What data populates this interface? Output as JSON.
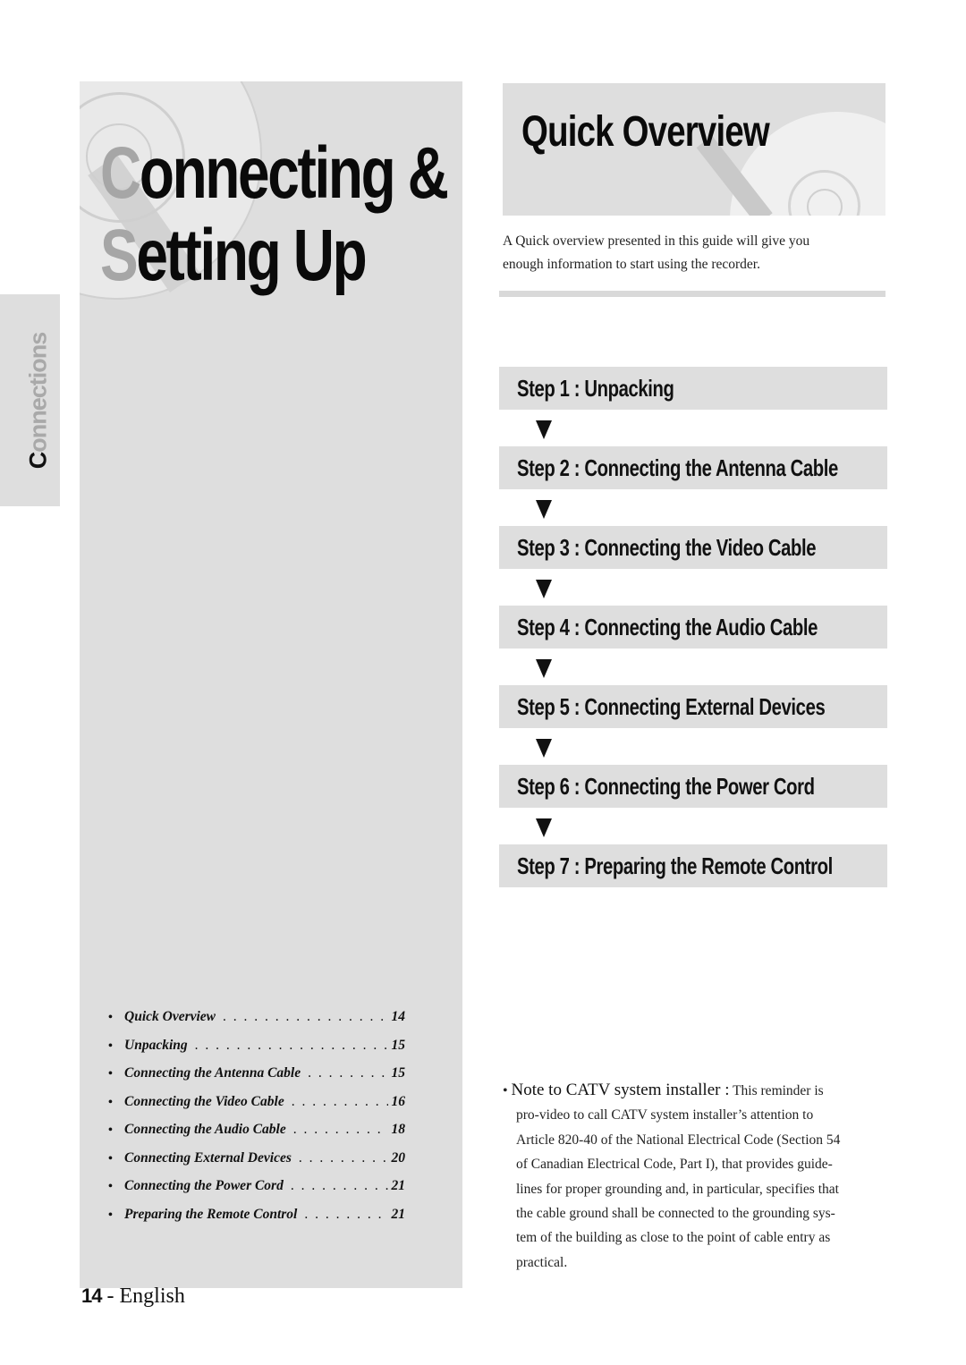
{
  "chapter": {
    "title_line1_initial": "C",
    "title_line1_rest": "onnecting &",
    "title_line2_initial": "S",
    "title_line2_rest": "etting Up"
  },
  "side_tab": {
    "initial": "C",
    "rest": "onnections"
  },
  "toc": [
    {
      "label": "Quick Overview",
      "page": "14"
    },
    {
      "label": "Unpacking",
      "page": "15"
    },
    {
      "label": "Connecting the Antenna Cable",
      "page": "15"
    },
    {
      "label": "Connecting the Video Cable",
      "page": "16"
    },
    {
      "label": "Connecting the Audio Cable",
      "page": "18"
    },
    {
      "label": "Connecting External Devices",
      "page": "20"
    },
    {
      "label": "Connecting the Power Cord",
      "page": "21"
    },
    {
      "label": "Preparing the Remote Control",
      "page": "21"
    }
  ],
  "toc_bullet": "•",
  "footer": {
    "page_number": "14",
    "separator": " - ",
    "language": "English"
  },
  "section": {
    "title": "Quick Overview",
    "intro_line1": "A Quick overview presented in this guide will give you",
    "intro_line2": "enough information to start using the recorder."
  },
  "steps": [
    {
      "label": "Step 1 : Unpacking"
    },
    {
      "label": "Step 2 : Connecting the Antenna Cable"
    },
    {
      "label": "Step 3 : Connecting the Video Cable"
    },
    {
      "label": "Step 4 : Connecting the Audio Cable"
    },
    {
      "label": "Step 5 : Connecting External Devices"
    },
    {
      "label": "Step 6 : Connecting the Power Cord"
    },
    {
      "label": "Step 7 : Preparing the Remote Control"
    }
  ],
  "note": {
    "bullet": "•",
    "heading": "Note to CATV system installer :",
    "lines": [
      "This reminder is",
      "pro-video to call CATV system installer’s attention to",
      "Article 820-40 of the National Electrical Code (Section 54",
      "of Canadian Electrical Code, Part I), that provides guide-",
      "lines for proper grounding and, in particular, specifies that",
      "the cable ground shall be connected to the grounding sys-",
      "tem of the building as close to the point of cable entry as",
      "practical."
    ]
  },
  "colors": {
    "panel_gray": "#dedede",
    "initial_gray": "#a6a6a6",
    "text": "#111111"
  }
}
